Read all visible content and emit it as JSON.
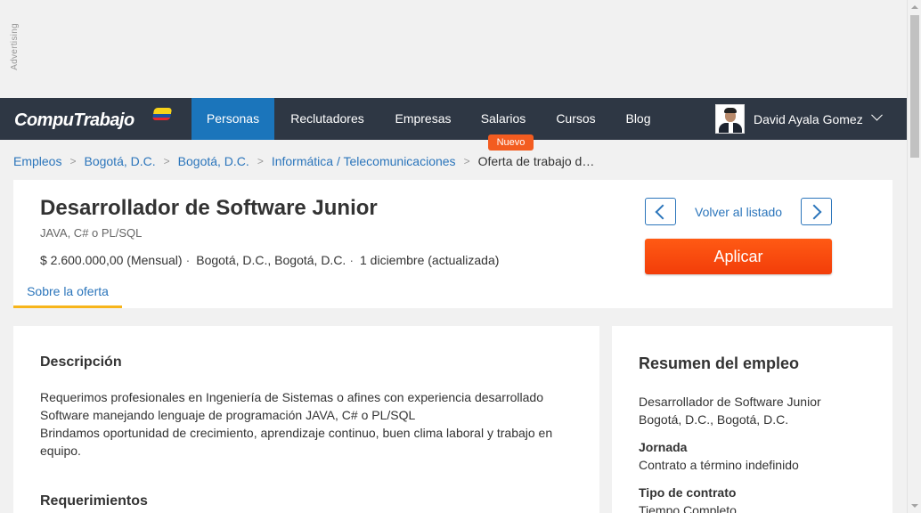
{
  "ad": {
    "label": "Advertising"
  },
  "navbar": {
    "logo": "CompuTrabajo",
    "items": [
      {
        "label": "Personas"
      },
      {
        "label": "Reclutadores"
      },
      {
        "label": "Empresas"
      },
      {
        "label": "Salarios"
      },
      {
        "label": "Cursos"
      },
      {
        "label": "Blog"
      }
    ],
    "badge": "Nuevo",
    "user_name": "David Ayala Gomez"
  },
  "breadcrumb": {
    "items": [
      "Empleos",
      "Bogotá, D.C.",
      "Bogotá, D.C.",
      "Informática / Telecomunicaciones"
    ],
    "current": "Oferta de trabajo d…"
  },
  "job": {
    "title": "Desarrollador de Software Junior",
    "subtitle": "JAVA, C# o PL/SQL",
    "salary": "$ 2.600.000,00 (Mensual)",
    "location": "Bogotá, D.C., Bogotá, D.C.",
    "date": "1 diciembre (actualizada)",
    "separator": "·",
    "tab": "Sobre la oferta",
    "back_label": "Volver al listado",
    "apply_label": "Aplicar"
  },
  "description": {
    "title": "Descripción",
    "lines": [
      "Requerimos profesionales en Ingeniería de Sistemas o afines con experiencia desarrollado",
      "Software manejando lenguaje de programación JAVA, C# o PL/SQL",
      "Brindamos oportunidad de crecimiento, aprendizaje continuo, buen clima laboral y trabajo en",
      "equipo."
    ],
    "requirements_title": "Requerimientos"
  },
  "summary": {
    "title": "Resumen del empleo",
    "job_title": "Desarrollador de Software Junior",
    "location": "Bogotá, D.C., Bogotá, D.C.",
    "jornada_label": "Jornada",
    "jornada_value": "Contrato a término indefinido",
    "tipo_label": "Tipo de contrato",
    "tipo_value": "Tiempo Completo"
  },
  "colors": {
    "navbar_bg": "#2e3744",
    "active_nav": "#1b75bb",
    "link": "#2b75bb",
    "apply_button": "#f23d09",
    "badge": "#f35c20",
    "tab_underline": "#f7b51b"
  }
}
